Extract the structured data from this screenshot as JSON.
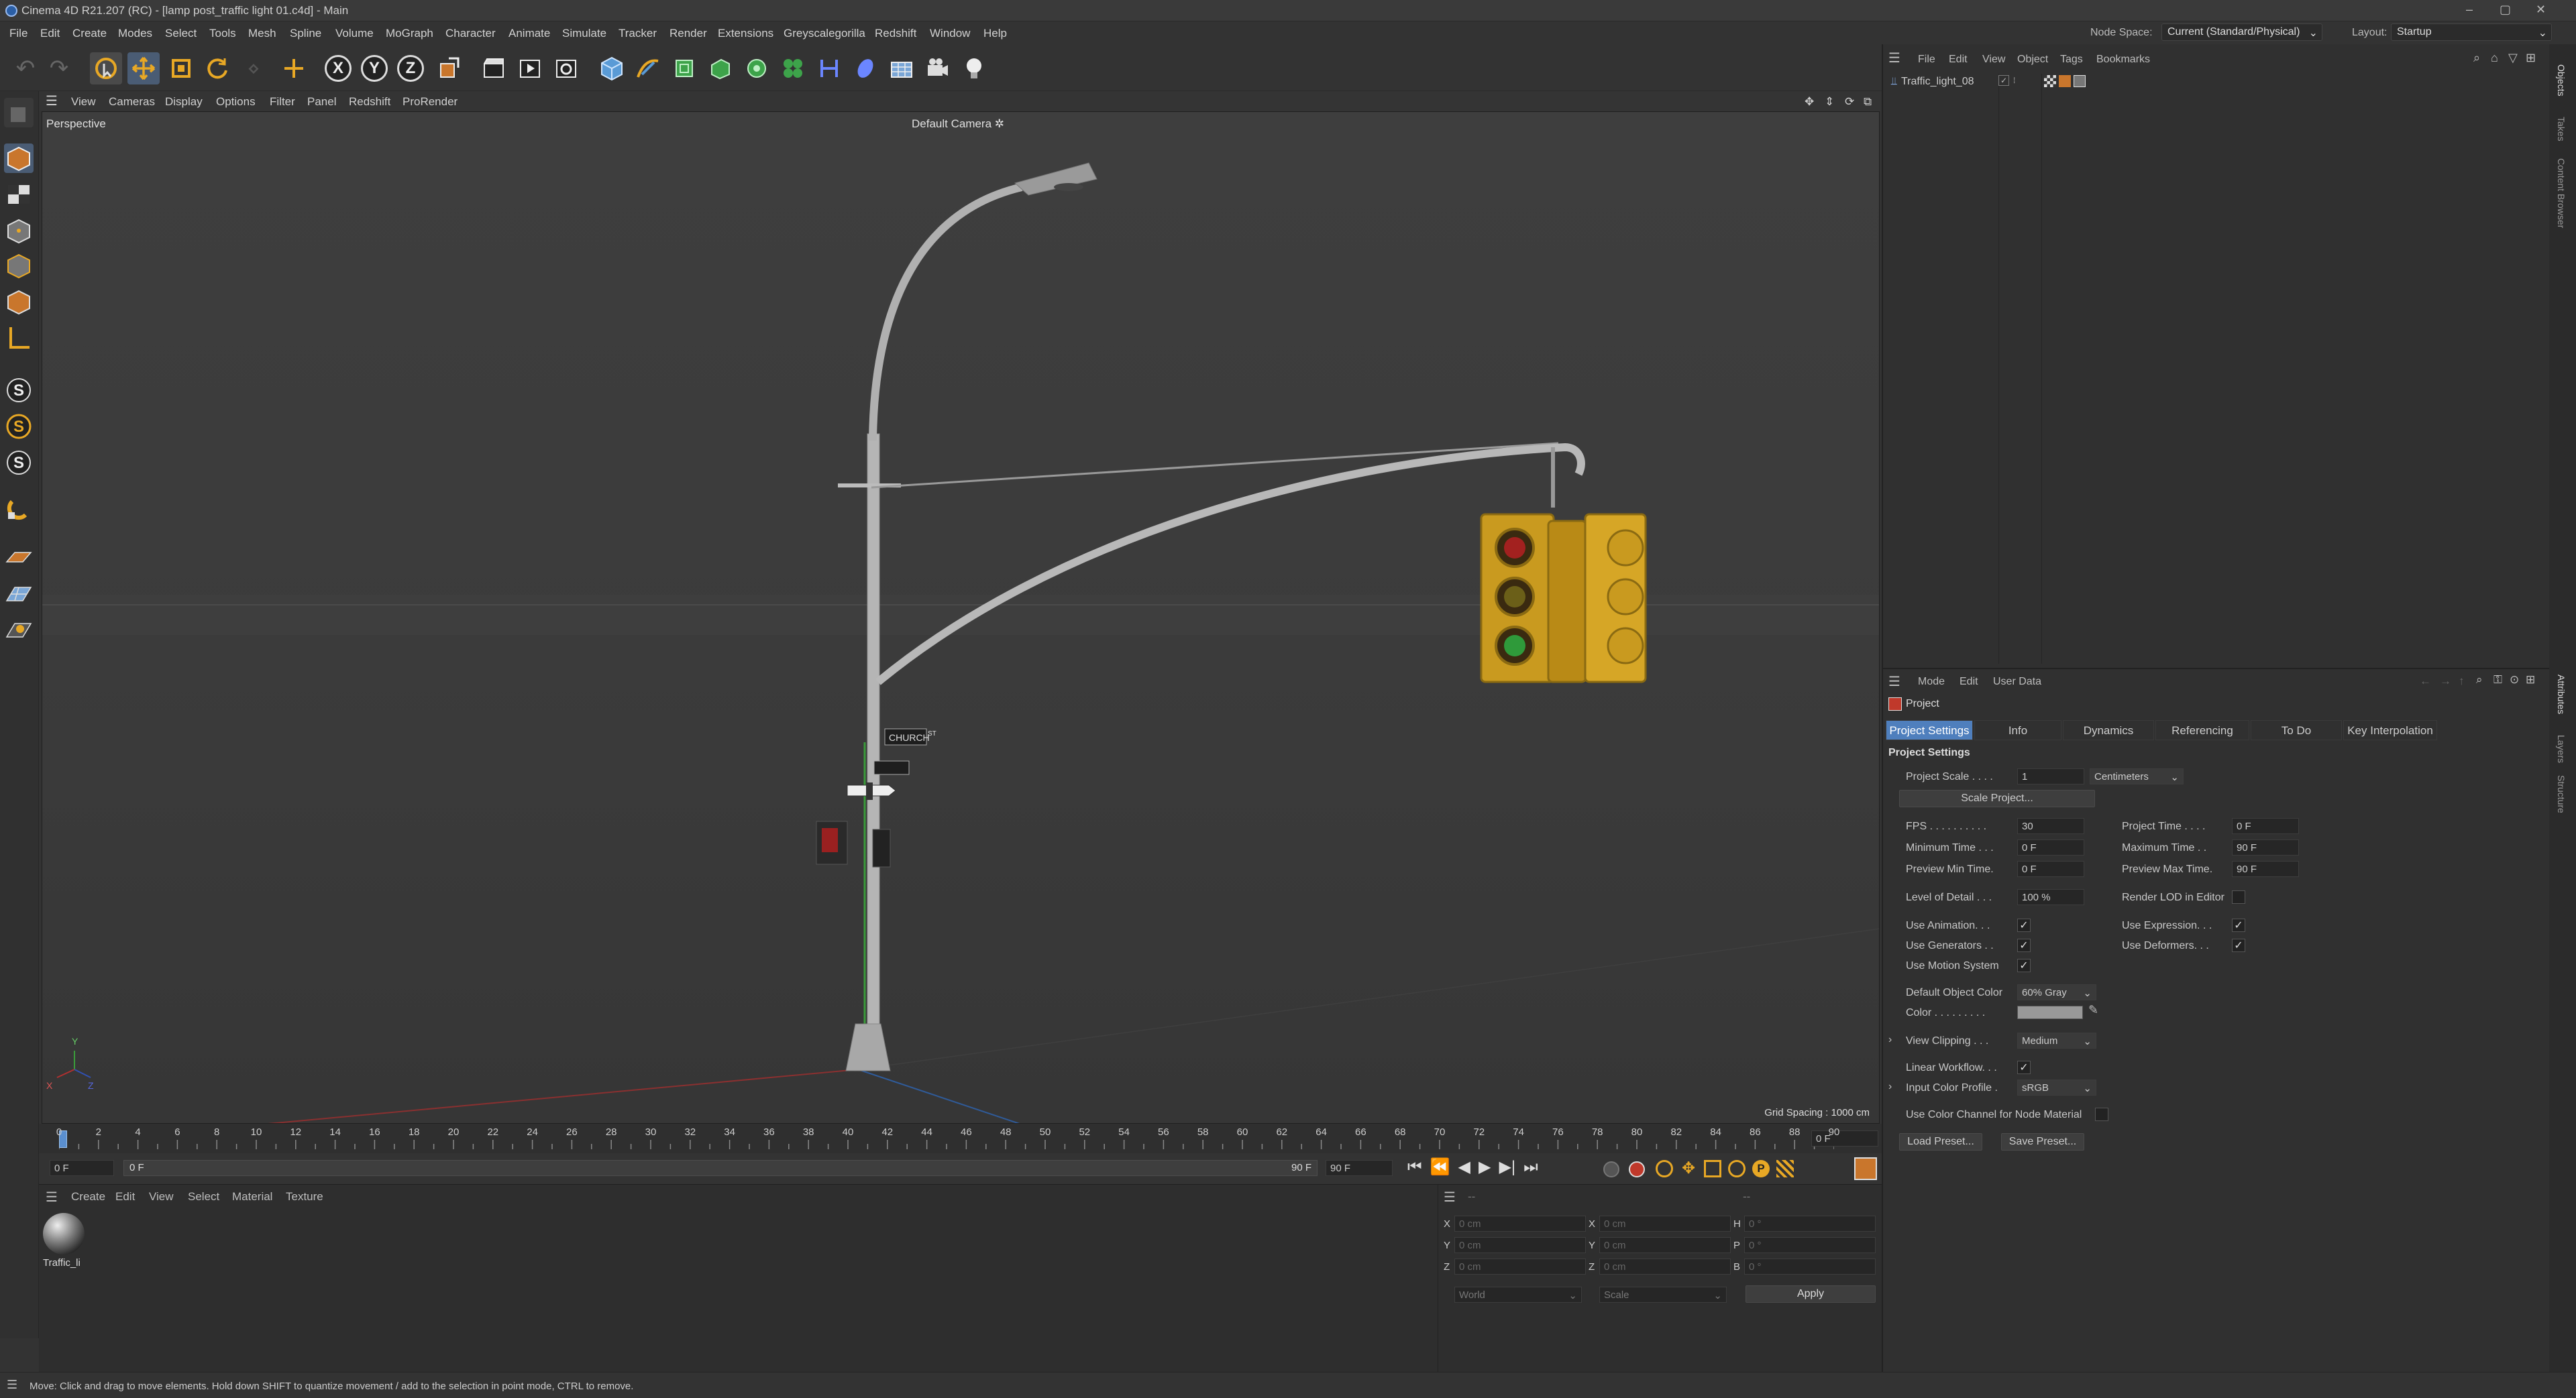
{
  "title_bar": {
    "text": "Cinema 4D R21.207 (RC) - [lamp post_traffic light 01.c4d] - Main",
    "min": "–",
    "max": "▢",
    "close": "✕"
  },
  "menu": {
    "items": [
      "File",
      "Edit",
      "Create",
      "Modes",
      "Select",
      "Tools",
      "Mesh",
      "Spline",
      "Volume",
      "MoGraph",
      "Character",
      "Animate",
      "Simulate",
      "Tracker",
      "Render",
      "Extensions",
      "Greyscalegorilla",
      "Redshift",
      "Window",
      "Help"
    ],
    "node_space_label": "Node Space:",
    "node_space_value": "Current (Standard/Physical)",
    "layout_label": "Layout:",
    "layout_value": "Startup"
  },
  "toolbar": {
    "x_label": "X",
    "y_label": "Y",
    "z_label": "Z"
  },
  "viewport": {
    "menu": [
      "View",
      "Cameras",
      "Display",
      "Options",
      "Filter",
      "Panel",
      "Redshift",
      "ProRender"
    ],
    "mode": "Perspective",
    "camera": "Default Camera",
    "grid_spacing": "Grid Spacing : 1000 cm",
    "axis_y": "Y",
    "axis_x": "X",
    "axis_z": "Z",
    "sign_text": "CHURCH",
    "sign_suffix": "ST"
  },
  "timeline": {
    "ticks": [
      "0",
      "2",
      "4",
      "6",
      "8",
      "10",
      "12",
      "14",
      "16",
      "18",
      "20",
      "22",
      "24",
      "26",
      "28",
      "30",
      "32",
      "34",
      "36",
      "38",
      "40",
      "42",
      "44",
      "46",
      "48",
      "50",
      "52",
      "54",
      "56",
      "58",
      "60",
      "62",
      "64",
      "66",
      "68",
      "70",
      "72",
      "74",
      "76",
      "78",
      "80",
      "82",
      "84",
      "86",
      "88",
      "90"
    ],
    "current_frame": "0 F"
  },
  "transport": {
    "start": "0 F",
    "range_start": "0 F",
    "range_end": "90 F",
    "end": "90 F"
  },
  "material_manager": {
    "menu": [
      "Create",
      "Edit",
      "View",
      "Select",
      "Material",
      "Texture"
    ],
    "material_name": "Traffic_li"
  },
  "coordinates": {
    "rows": [
      {
        "a": "X",
        "v1": "0 cm",
        "b": "X",
        "v2": "0 cm",
        "c": "H",
        "v3": "0 °"
      },
      {
        "a": "Y",
        "v1": "0 cm",
        "b": "Y",
        "v2": "0 cm",
        "c": "P",
        "v3": "0 °"
      },
      {
        "a": "Z",
        "v1": "0 cm",
        "b": "Z",
        "v2": "0 cm",
        "c": "B",
        "v3": "0 °"
      }
    ],
    "world": "World",
    "scale": "Scale",
    "apply": "Apply",
    "dash1": "--",
    "dash2": "--"
  },
  "object_manager": {
    "menu": [
      "File",
      "Edit",
      "View",
      "Object",
      "Tags",
      "Bookmarks"
    ],
    "object_name": "Traffic_light_08"
  },
  "attributes": {
    "menu": [
      "Mode",
      "Edit",
      "User Data"
    ],
    "header": "Project",
    "tabs": [
      "Project Settings",
      "Info",
      "Dynamics",
      "Referencing",
      "To Do",
      "Key Interpolation"
    ],
    "section": "Project Settings",
    "project_scale_label": "Project Scale . . . .",
    "project_scale_value": "1",
    "project_scale_unit": "Centimeters",
    "scale_project_btn": "Scale Project...",
    "fps_label": "FPS . . . . . . . . . .",
    "fps_value": "30",
    "project_time_label": "Project Time . . . .",
    "project_time_value": "0 F",
    "min_time_label": "Minimum Time . . .",
    "min_time_value": "0 F",
    "max_time_label": "Maximum Time . .",
    "max_time_value": "90 F",
    "prev_min_label": "Preview Min Time.",
    "prev_min_value": "0 F",
    "prev_max_label": "Preview Max Time.",
    "prev_max_value": "90 F",
    "lod_label": "Level of Detail . . .",
    "lod_value": "100 %",
    "render_lod_label": "Render LOD in Editor",
    "use_anim_label": "Use Animation. . .",
    "use_expr_label": "Use Expression. . .",
    "use_gen_label": "Use Generators . .",
    "use_def_label": "Use Deformers. . .",
    "use_motion_label": "Use Motion System",
    "def_obj_color_label": "Default Object Color",
    "def_obj_color_value": "60% Gray",
    "color_label": "Color . . . . . . . . .",
    "view_clip_label": "View Clipping . . .",
    "view_clip_value": "Medium",
    "linear_wf_label": "Linear Workflow. . .",
    "input_color_label": "Input Color Profile .",
    "input_color_value": "sRGB",
    "use_color_channel_label": "Use Color Channel for Node Material",
    "load_preset": "Load Preset...",
    "save_preset": "Save Preset..."
  },
  "right_strip": {
    "tabs": [
      "Objects",
      "Takes",
      "Content Browser"
    ],
    "tabs2": [
      "Attributes",
      "Layers",
      "Structure"
    ]
  },
  "status": {
    "text": "Move: Click and drag to move elements. Hold down SHIFT to quantize movement / add to the selection in point mode, CTRL to remove."
  },
  "colors": {
    "accent": "#5a8fd0",
    "tab_active": "#4f7fbd"
  }
}
